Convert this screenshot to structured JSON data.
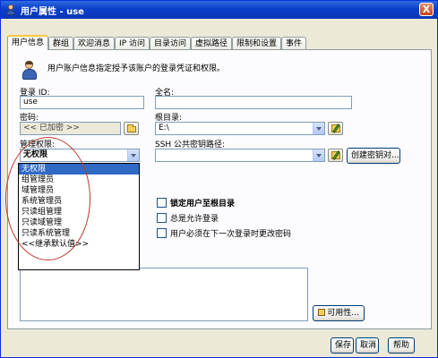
{
  "window": {
    "title": "用户属性 - use",
    "close_label": "X"
  },
  "tabs": [
    {
      "label": "用户信息",
      "active": true
    },
    {
      "label": "群组"
    },
    {
      "label": "欢迎消息"
    },
    {
      "label": "IP 访问"
    },
    {
      "label": "目录访问"
    },
    {
      "label": "虚拟路径"
    },
    {
      "label": "限制和设置"
    },
    {
      "label": "事件"
    }
  ],
  "description": "用户账户信息指定授予该账户的登录凭证和权限。",
  "fields": {
    "login_id": {
      "label": "登录 ID:",
      "value": "use"
    },
    "full_name": {
      "label": "全名:",
      "value": ""
    },
    "password": {
      "label": "密码:",
      "value": "<< 已加密 >>"
    },
    "root_dir": {
      "label": "根目录:",
      "value": "E:\\"
    },
    "admin_rights": {
      "label": "管理权限:",
      "value": "无权限"
    },
    "ssh_key_path": {
      "label": "SSH 公共密钥路径:",
      "value": ""
    }
  },
  "admin_options": [
    "无权限",
    "组管理员",
    "域管理员",
    "系统管理员",
    "只读组管理",
    "只读域管理",
    "只读系统管理",
    "<<继承默认值>>"
  ],
  "checkboxes": [
    {
      "label": "锁定用户至根目录",
      "checked": false
    },
    {
      "label": "总是允许登录",
      "checked": false
    },
    {
      "label": "用户必须在下一次登录时更改密码",
      "checked": false
    }
  ],
  "buttons": {
    "create_key": "创建密钥对...",
    "availability": "可用性...",
    "save": "保存",
    "cancel": "取消",
    "help": "帮助"
  },
  "colors": {
    "titlebar": "#0a3fc8",
    "selection": "#316ac5",
    "annotation": "#c0392b"
  }
}
